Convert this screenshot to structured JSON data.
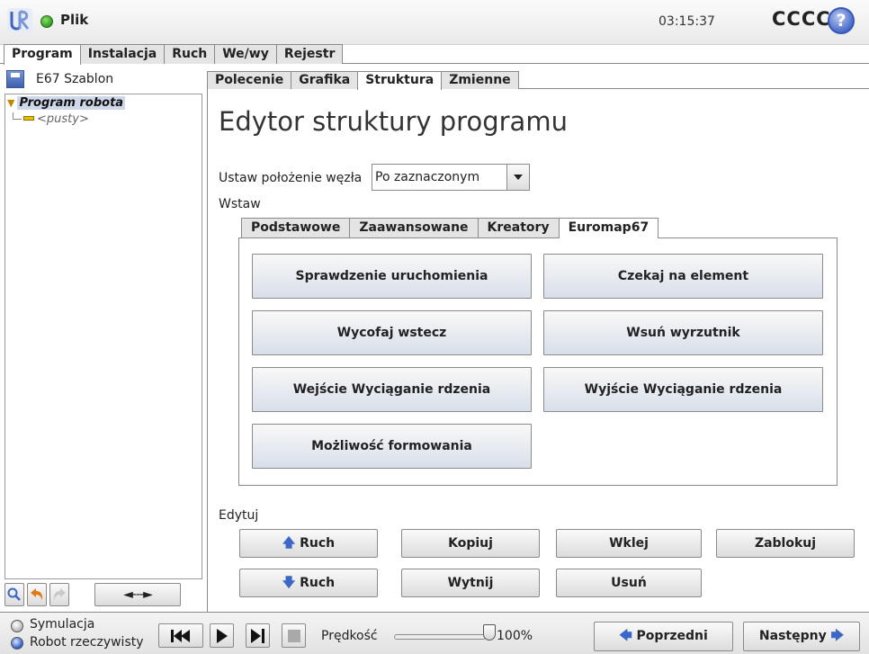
{
  "titlebar": {
    "menu_label": "Plik",
    "time": "03:15:37",
    "robot_name": "CCCC",
    "help_symbol": "?",
    "logo_icon": "universal-robots-logo",
    "status_color": "#2e9a1e"
  },
  "main_tabs": [
    {
      "label": "Program",
      "active": true
    },
    {
      "label": "Instalacja",
      "active": false
    },
    {
      "label": "Ruch",
      "active": false
    },
    {
      "label": "We/wy",
      "active": false
    },
    {
      "label": "Rejestr",
      "active": false
    }
  ],
  "left_panel": {
    "template_name": "E67 Szablon",
    "tree_root": "Program robota",
    "tree_child": "<pusty>",
    "move_label": "◄---►"
  },
  "sub_tabs": [
    {
      "label": "Polecenie",
      "active": false
    },
    {
      "label": "Grafika",
      "active": false
    },
    {
      "label": "Struktura",
      "active": true
    },
    {
      "label": "Zmienne",
      "active": false
    }
  ],
  "editor": {
    "title": "Edytor struktury programu",
    "position_label": "Ustaw położenie węzła",
    "position_value": "Po zaznaczonym",
    "insert_label": "Wstaw",
    "insert_tabs": [
      {
        "label": "Podstawowe",
        "active": false
      },
      {
        "label": "Zaawansowane",
        "active": false
      },
      {
        "label": "Kreatory",
        "active": false
      },
      {
        "label": "Euromap67",
        "active": true
      }
    ],
    "insert_buttons": {
      "startup_check": "Sprawdzenie uruchomienia",
      "wait_part": "Czekaj na element",
      "retract_back": "Wycofaj wstecz",
      "insert_ejector": "Wsuń wyrzutnik",
      "core_pull_in": "Wejście Wyciąganie rdzenia",
      "core_pull_out": "Wyjście Wyciąganie rdzenia",
      "molding_possible": "Możliwość formowania"
    },
    "edit_label": "Edytuj",
    "edit_buttons": {
      "move_up": "Ruch",
      "copy": "Kopiuj",
      "paste": "Wklej",
      "lock": "Zablokuj",
      "move_down": "Ruch",
      "cut": "Wytnij",
      "delete": "Usuń"
    }
  },
  "footer": {
    "simulation_label": "Symulacja",
    "real_robot_label": "Robot rzeczywisty",
    "simulation_selected": false,
    "real_robot_selected": true,
    "speed_label": "Prędkość",
    "speed_value": "100%",
    "speed_fraction": 1.0,
    "prev_label": "Poprzedni",
    "next_label": "Następny"
  },
  "colors": {
    "accent_blue": "#3b67c7",
    "undo_orange": "#e07b1a",
    "tree_selection": "#cfd7ea"
  }
}
